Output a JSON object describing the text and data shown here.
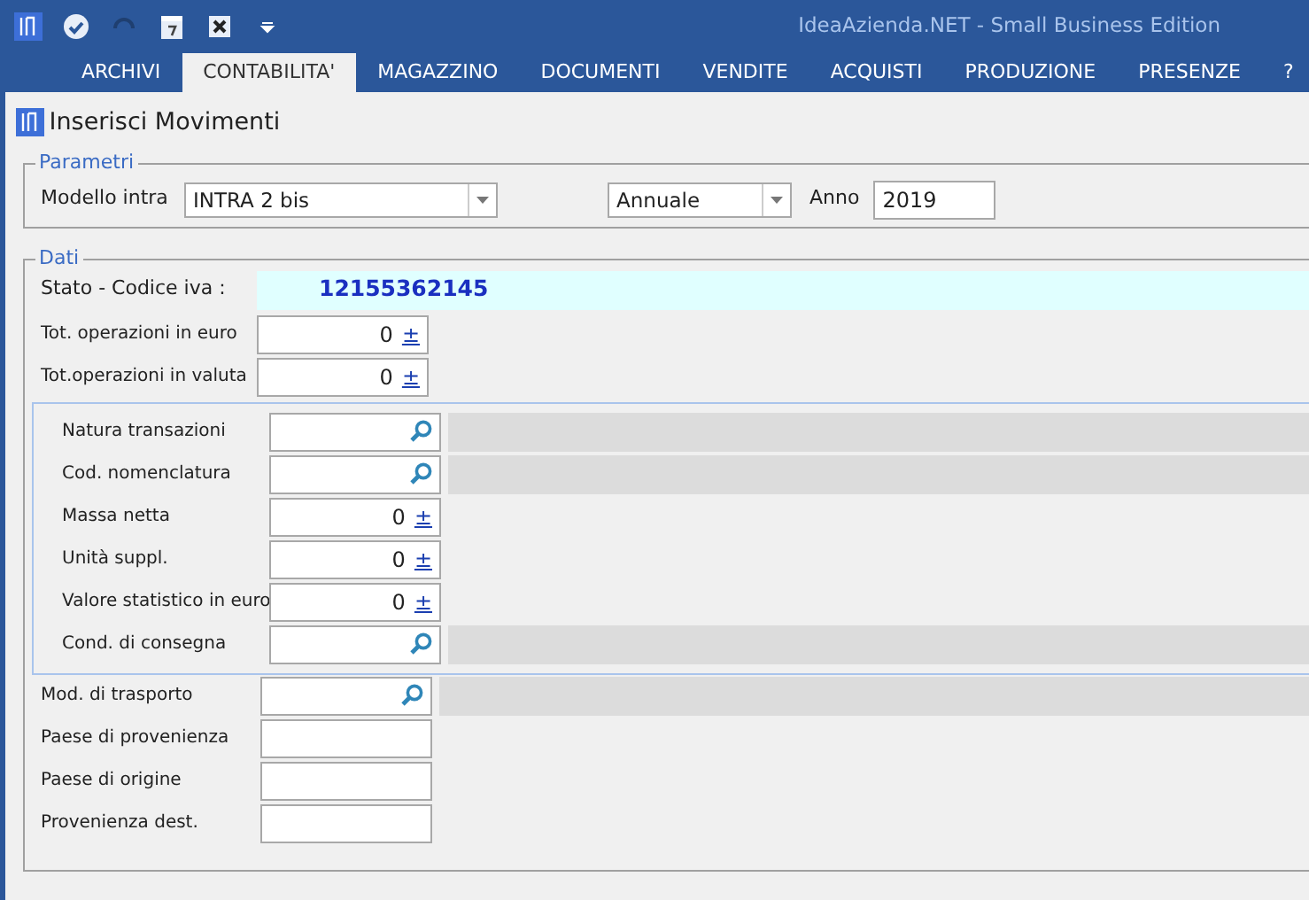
{
  "window": {
    "title": "IdeaAzienda.NET - Small Business Edition"
  },
  "quick_toolbar": [
    {
      "kind": "check"
    },
    {
      "kind": "undo",
      "disabled": true
    },
    {
      "kind": "calc"
    },
    {
      "kind": "excel"
    },
    {
      "kind": "more"
    }
  ],
  "menu": [
    {
      "label": "ARCHIVI",
      "selected": false
    },
    {
      "label": "CONTABILITA'",
      "selected": true
    },
    {
      "label": "MAGAZZINO",
      "selected": false
    },
    {
      "label": "DOCUMENTI",
      "selected": false
    },
    {
      "label": "VENDITE",
      "selected": false
    },
    {
      "label": "ACQUISTI",
      "selected": false
    },
    {
      "label": "PRODUZIONE",
      "selected": false
    },
    {
      "label": "PRESENZE",
      "selected": false
    },
    {
      "label": "?",
      "selected": false
    }
  ],
  "form_title": "Inserisci Movimenti",
  "parametri": {
    "legend": "Parametri",
    "modello_label": "Modello intra",
    "modello_value": "INTRA 2 bis",
    "periodo_value": "Annuale",
    "anno_label": "Anno",
    "anno_value": "2019"
  },
  "dati": {
    "legend": "Dati",
    "stato_label": "Stato - Codice iva :",
    "stato_value": "12155362145",
    "totals": [
      {
        "label": "Tot. operazioni in euro",
        "kind": "number",
        "value": "0",
        "spin": "±"
      },
      {
        "label": "Tot.operazioni in valuta",
        "kind": "number",
        "value": "0",
        "spin": "±"
      }
    ],
    "detail": [
      {
        "label": "Natura transazioni",
        "kind": "lookup"
      },
      {
        "label": "Cod. nomenclatura",
        "kind": "lookup"
      },
      {
        "label": "Massa netta",
        "kind": "number",
        "value": "0",
        "spin": "±"
      },
      {
        "label": "Unità suppl.",
        "kind": "number",
        "value": "0",
        "spin": "±"
      },
      {
        "label": "Valore statistico in euro",
        "kind": "number",
        "value": "0",
        "spin": "±"
      },
      {
        "label": "Cond. di consegna",
        "kind": "lookup"
      }
    ],
    "other": [
      {
        "label": "Mod. di trasporto",
        "kind": "lookup"
      },
      {
        "label": "Paese di provenienza",
        "kind": "text"
      },
      {
        "label": "Paese di origine",
        "kind": "text"
      },
      {
        "label": "Provenienza dest.",
        "kind": "text"
      }
    ]
  }
}
